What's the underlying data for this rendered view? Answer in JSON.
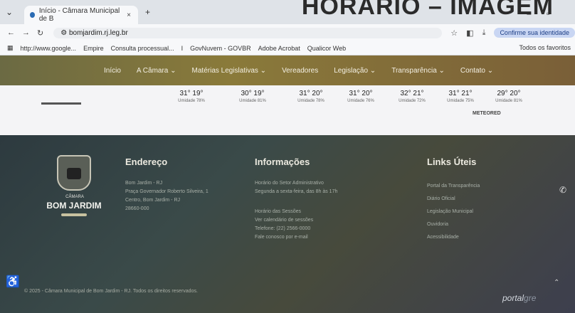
{
  "browser": {
    "tab_title": "Início - Câmara Municipal de B",
    "tab_close": "×",
    "new_tab": "+",
    "url": "bomjardim.rj.leg.br",
    "identity_button": "Confirme sua identidade",
    "overlay_title": "HORÁRIO – IMAGEM",
    "bookmarks": [
      "http://www.google...",
      "Empire",
      "Consulta processual...",
      "I",
      "GovNuvem - GOVBR",
      "Adobe Acrobat",
      "Qualicor Web"
    ],
    "all_bookmarks": "Todos os favoritos"
  },
  "site": {
    "nav": [
      "Início",
      "A Câmara ⌄",
      "Matérias Legislativas ⌄",
      "Vereadores",
      "Legislação ⌄",
      "Transparência ⌄",
      "Contato ⌄"
    ],
    "weather": [
      {
        "temp": "31° 19°",
        "hum": "Umidade 78%"
      },
      {
        "temp": "30° 19°",
        "hum": "Umidade 81%"
      },
      {
        "temp": "31° 20°",
        "hum": "Umidade 78%"
      },
      {
        "temp": "31° 20°",
        "hum": "Umidade 76%"
      },
      {
        "temp": "32° 21°",
        "hum": "Umidade 72%"
      },
      {
        "temp": "31° 21°",
        "hum": "Umidade 75%"
      },
      {
        "temp": "29° 20°",
        "hum": "Umidade 81%"
      }
    ],
    "weather_provider": "METEORED",
    "footer": {
      "brand_top": "CÂMARA",
      "brand_name": "BOM JARDIM",
      "endereco_title": "Endereço",
      "endereco_lines": [
        "Bom Jardim - RJ",
        "Praça Governador Roberto Silveira, 1",
        "Centro, Bom Jardim - RJ",
        "28660-000"
      ],
      "informacoes_title": "Informações",
      "informacoes_lines": [
        "Horário do Setor Administrativo",
        "Segunda a sexta-feira, das 8h às 17h",
        "Horário das Sessões",
        "Ver calendário de sessões",
        "Telefone: (22) 2566-0000",
        "Fale conosco por e-mail"
      ],
      "links_title": "Links Úteis",
      "links_lines": [
        "Portal da Transparência",
        "Diário Oficial",
        "Legislação Municipal",
        "Ouvidoria",
        "Acessibilidade"
      ],
      "copyright": "© 2025 - Câmara Municipal de Bom Jardim - RJ. Todos os direitos reservados.",
      "portal_name": "portal",
      "portal_suffix": "gre"
    }
  }
}
